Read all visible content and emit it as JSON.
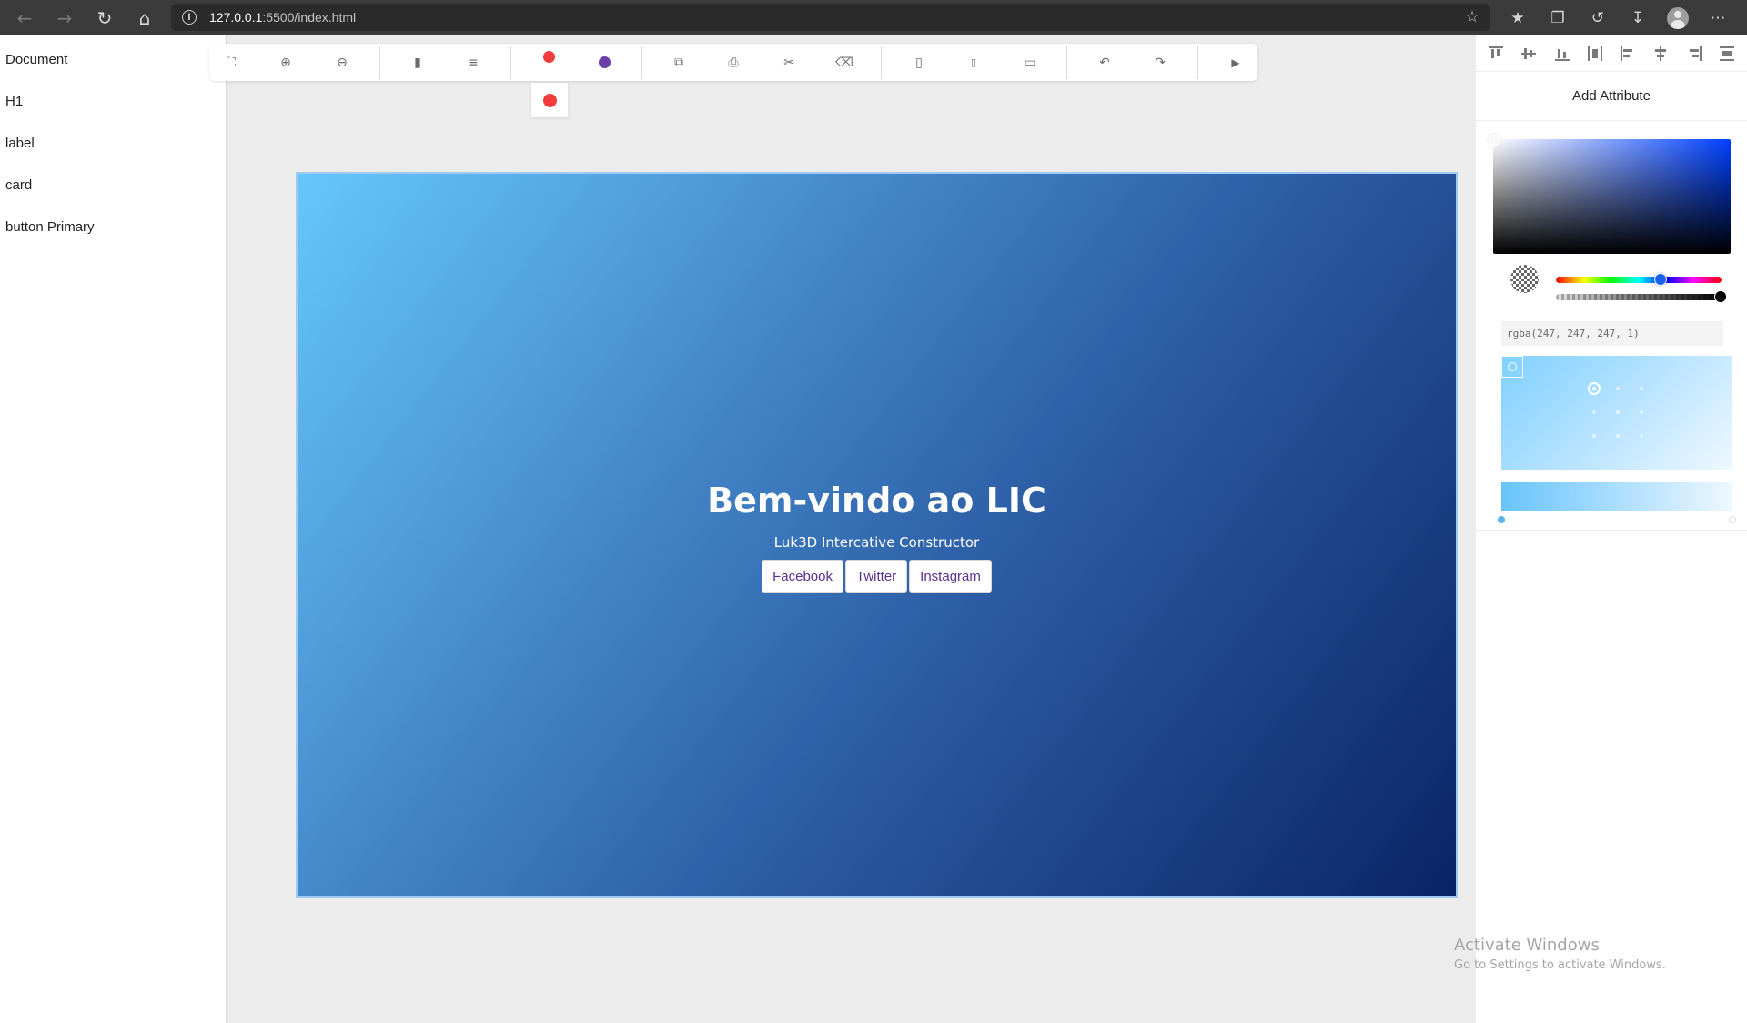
{
  "browser": {
    "url_host": "127.0.0.1",
    "url_path": ":5500/index.html",
    "icons": [
      "back-icon",
      "forward-icon",
      "reload-icon",
      "home-icon",
      "info-icon",
      "favorite-add-icon",
      "favorites-icon",
      "collections-icon",
      "history-icon",
      "download-icon",
      "profile-avatar",
      "more-icon"
    ]
  },
  "layers": {
    "items": [
      {
        "label": "Document"
      },
      {
        "label": "H1"
      },
      {
        "label": "label"
      },
      {
        "label": "card"
      },
      {
        "label": "button Primary"
      }
    ]
  },
  "toolbar": {
    "icons": [
      "fullscreen-icon",
      "zoom-in-icon",
      "zoom-out-icon",
      "columns-icon",
      "rows-icon",
      "color-red-dot",
      "color-purple-dot",
      "copy-icon",
      "paste-icon",
      "cut-icon",
      "delete-icon",
      "mobile-icon",
      "tablet-icon",
      "desktop-icon",
      "undo-icon",
      "redo-icon",
      "play-icon"
    ],
    "colors": {
      "red": "#f23b3b",
      "purple": "#6a3fa8"
    }
  },
  "canvas": {
    "title": "Bem-vindo ao LIC",
    "subtitle": "Luk3D Intercative Constructor",
    "buttons": [
      {
        "label": "Facebook"
      },
      {
        "label": "Twitter"
      },
      {
        "label": "Instagram"
      }
    ],
    "gradient_colors": [
      "#66c7fc",
      "#0a2466"
    ]
  },
  "right_panel": {
    "align_icons": [
      "align-top-icon",
      "align-vertical-center-icon",
      "align-bottom-icon",
      "distribute-vertical-icon",
      "align-left-icon",
      "align-horizontal-center-icon",
      "align-right-icon",
      "distribute-horizontal-icon"
    ],
    "add_attribute_label": "Add Attribute",
    "color_value": "rgba(247, 247, 247, 1)"
  },
  "watermark": {
    "line1": "Activate Windows",
    "line2": "Go to Settings to activate Windows."
  }
}
